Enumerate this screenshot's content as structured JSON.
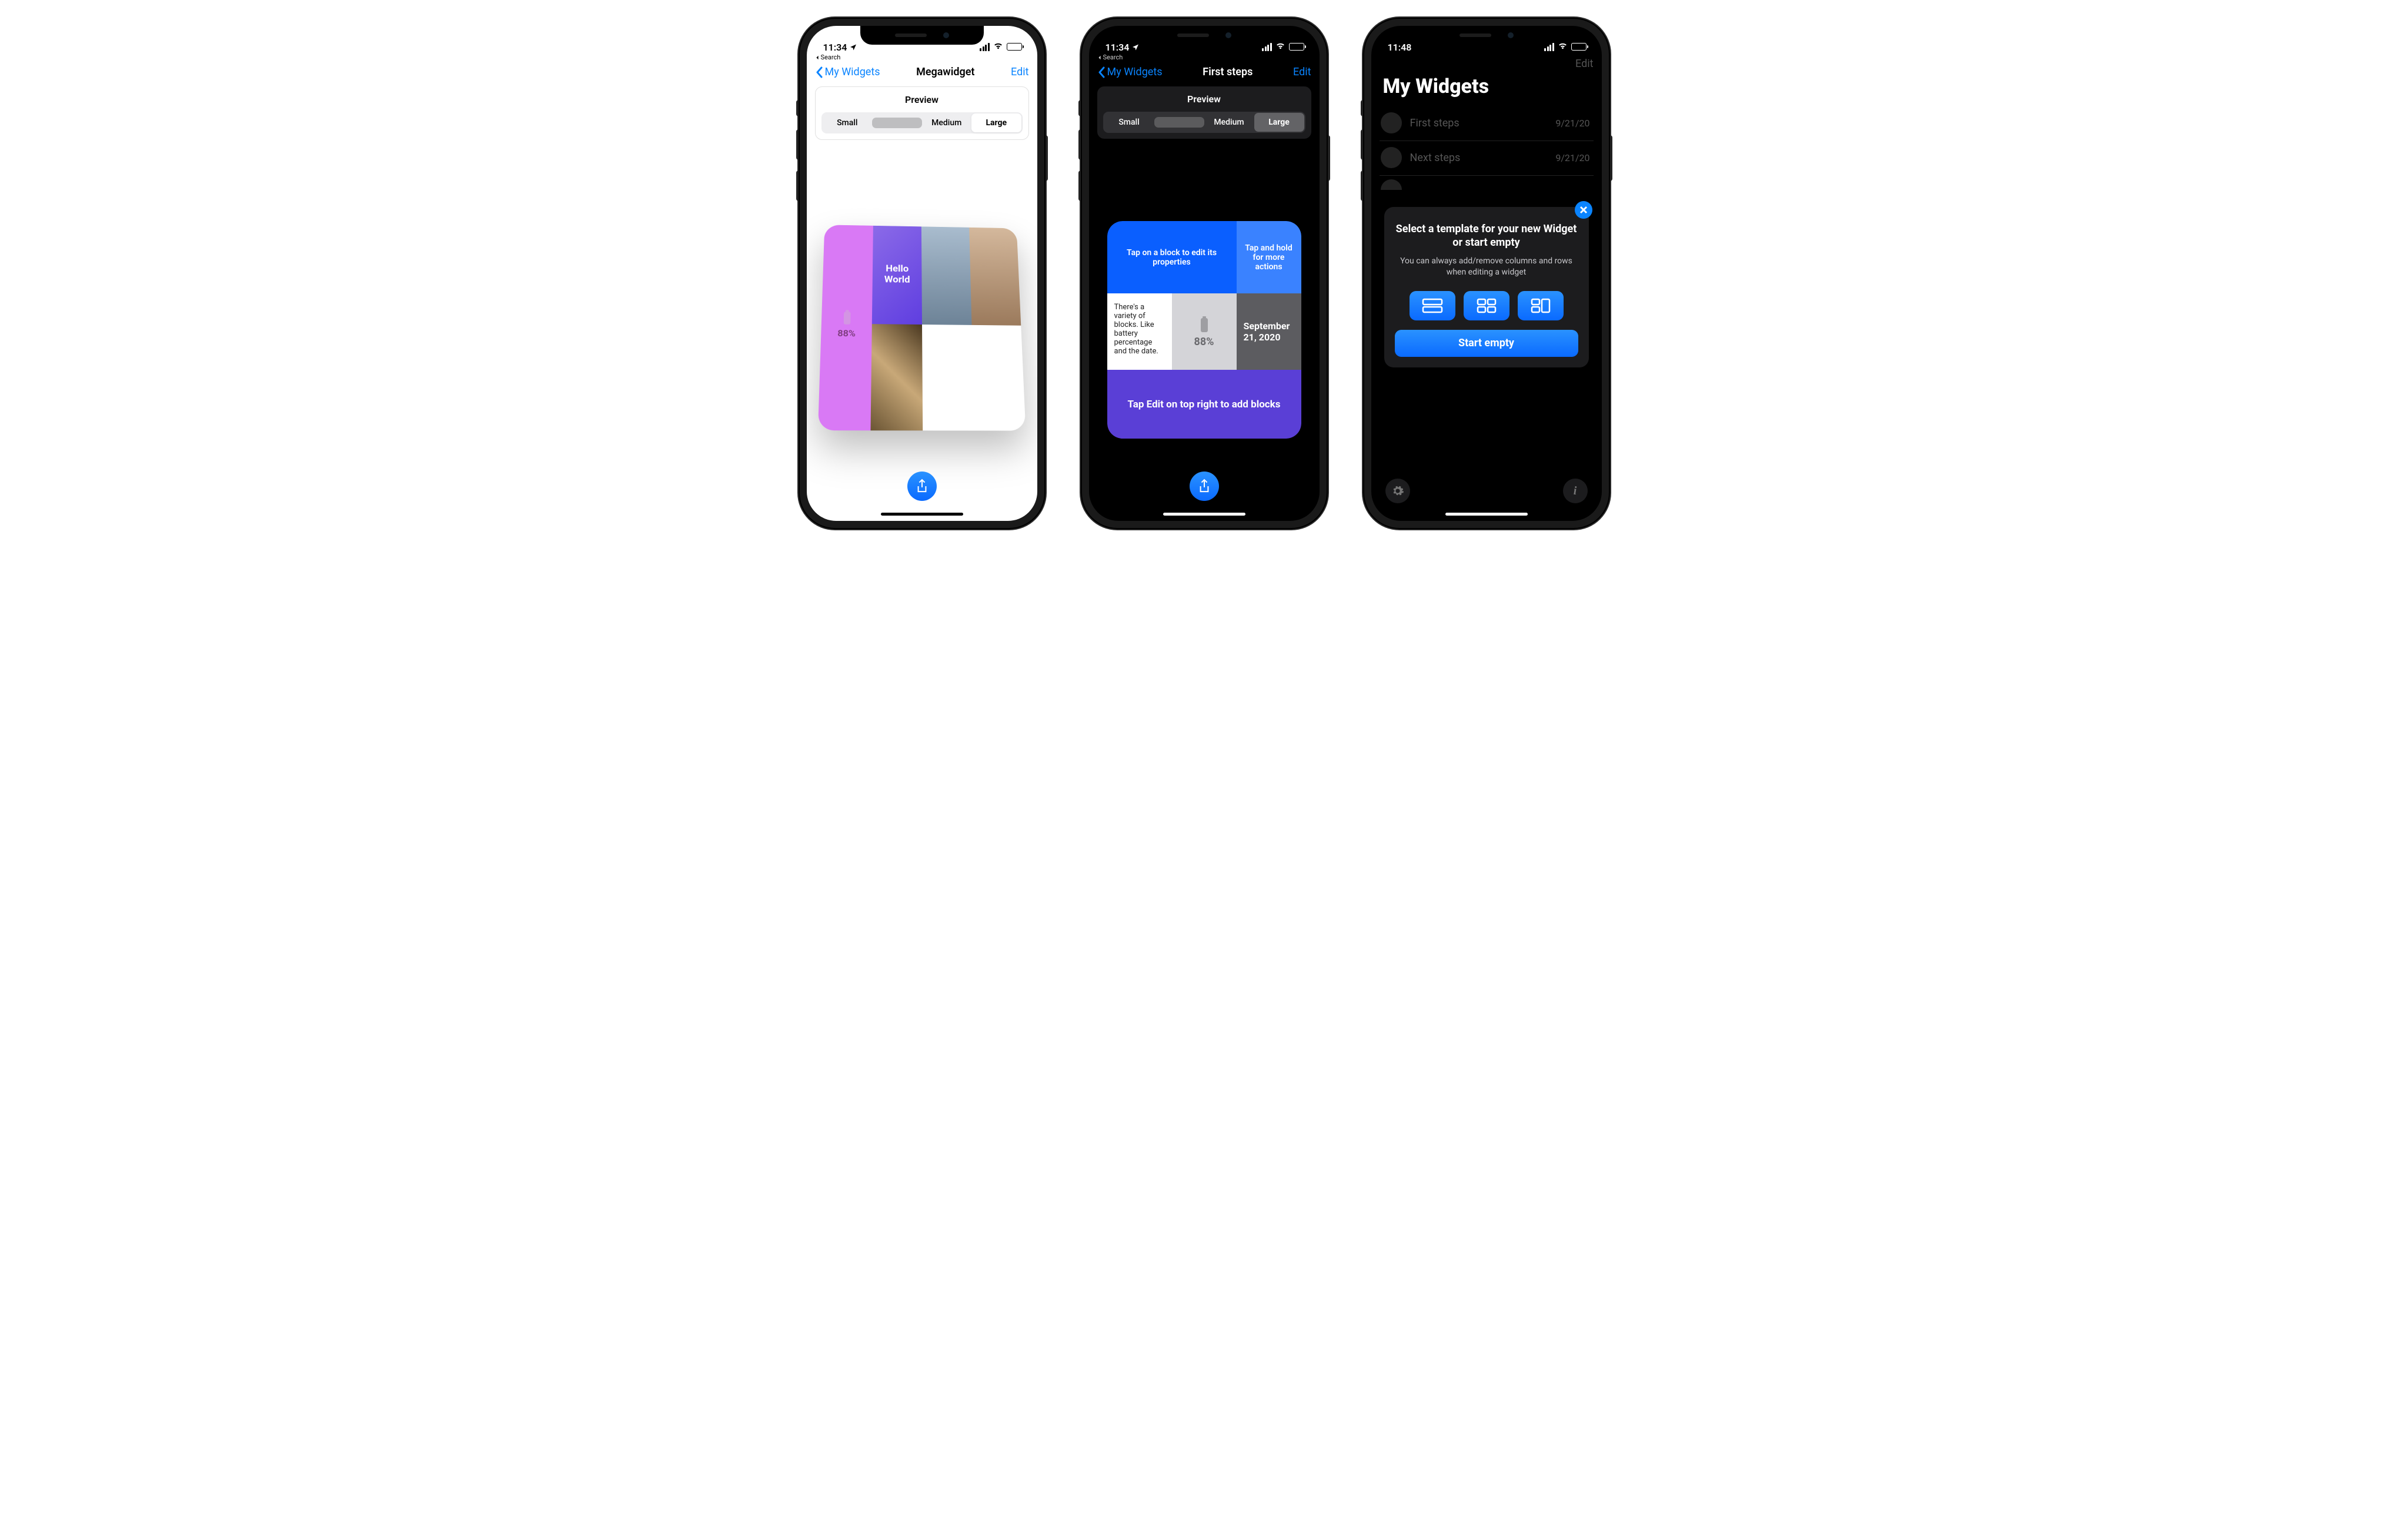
{
  "phone1": {
    "status": {
      "time": "11:34",
      "breadcrumb": "Search"
    },
    "nav": {
      "back": "My Widgets",
      "title": "Megawidget",
      "edit": "Edit"
    },
    "preview": {
      "label": "Preview",
      "seg": {
        "small": "Small",
        "medium": "Medium",
        "large": "Large",
        "selected": "Large"
      }
    },
    "widget": {
      "hello": "Hello World",
      "battery": "88%"
    }
  },
  "phone2": {
    "status": {
      "time": "11:34",
      "breadcrumb": "Search"
    },
    "nav": {
      "back": "My Widgets",
      "title": "First steps",
      "edit": "Edit"
    },
    "preview": {
      "label": "Preview",
      "seg": {
        "small": "Small",
        "medium": "Medium",
        "large": "Large",
        "selected": "Large"
      }
    },
    "widget": {
      "tap_edit_prop": "Tap on a block to edit its properties",
      "tap_hold": "Tap and hold for more actions",
      "variety": "There's a variety of blocks. Like battery percentage and the date.",
      "battery": "88%",
      "date": "September 21, 2020",
      "add_blocks": "Tap Edit on top right to add blocks"
    }
  },
  "phone3": {
    "status": {
      "time": "11:48"
    },
    "nav": {
      "edit": "Edit"
    },
    "title": "My Widgets",
    "list": [
      {
        "label": "First steps",
        "date": "9/21/20"
      },
      {
        "label": "Next steps",
        "date": "9/21/20"
      }
    ],
    "popover": {
      "heading": "Select a template for your new Widget or start empty",
      "sub": "You can always add/remove columns and rows when editing a widget",
      "start_empty": "Start empty"
    }
  }
}
